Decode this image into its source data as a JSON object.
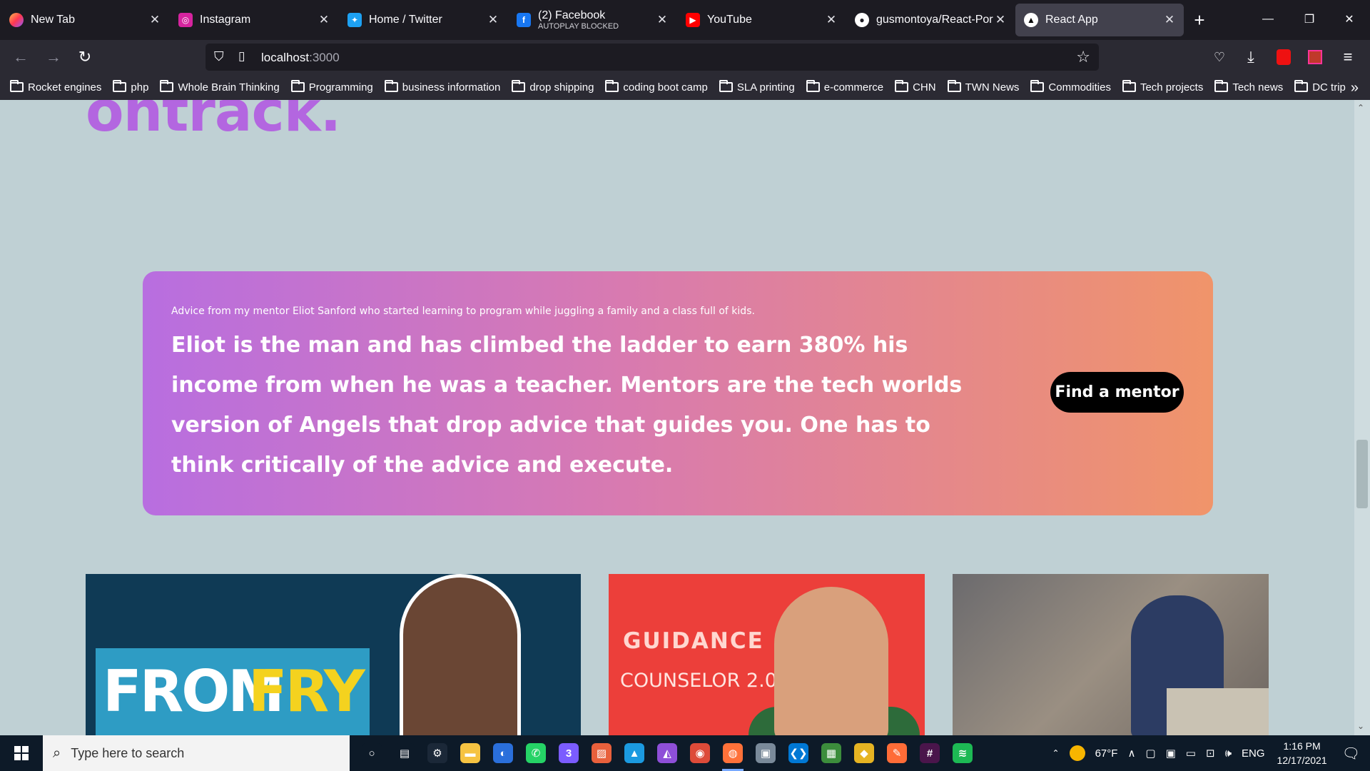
{
  "tabs": [
    {
      "title": "New Tab",
      "subtitle": "",
      "icon": "firefox-icon",
      "color": "#ff7139",
      "glyph": ""
    },
    {
      "title": "Instagram",
      "subtitle": "",
      "icon": "instagram-icon",
      "color": "#d6249f",
      "glyph": "◎"
    },
    {
      "title": "Home / Twitter",
      "subtitle": "",
      "icon": "twitter-icon",
      "color": "#1da1f2",
      "glyph": "✦"
    },
    {
      "title": "(2) Facebook",
      "subtitle": "AUTOPLAY BLOCKED",
      "icon": "facebook-icon",
      "color": "#1877f2",
      "glyph": "f"
    },
    {
      "title": "YouTube",
      "subtitle": "",
      "icon": "youtube-icon",
      "color": "#ff0000",
      "glyph": "▶"
    },
    {
      "title": "gusmontoya/React-Portf",
      "subtitle": "",
      "icon": "github-icon",
      "color": "#ffffff",
      "glyph": "●"
    },
    {
      "title": "React App",
      "subtitle": "",
      "icon": "react-app-icon",
      "color": "#000000",
      "glyph": "▲"
    }
  ],
  "url": {
    "host": "localhost",
    "port": ":3000"
  },
  "bookmarks": [
    "Rocket engines",
    "php",
    "Whole Brain Thinking",
    "Programming",
    "business information",
    "drop shipping",
    "coding boot camp",
    "SLA printing",
    "e-commerce",
    "CHN",
    "TWN News",
    "Commodities",
    "Tech projects",
    "Tech news",
    "DC trip"
  ],
  "page": {
    "heading_fragment": "ontrack.",
    "banner": {
      "subtitle": "Advice from my mentor Eliot Sanford who started learning to program while juggling a family and a class full of kids.",
      "quote": "Eliot is the man and has climbed the ladder to earn 380% his income from when he was a teacher. Mentors are the tech worlds version of Angels that drop advice that guides you. One has to think critically of the advice and execute.",
      "button_label": "Find a mentor"
    },
    "cards": [
      {
        "text_a": "FROM",
        "text_b": "FRY"
      },
      {
        "text_a": "GUIDANCE",
        "text_b": "COUNSELOR 2.0"
      },
      {
        "text_a": "",
        "text_b": ""
      }
    ],
    "colors": {
      "accent": "#b366e0",
      "background": "#bfd0d4",
      "gradient_start": "#b86ee0",
      "gradient_end": "#f0946a"
    }
  },
  "taskbar": {
    "search_placeholder": "Type here to search",
    "apps": [
      {
        "name": "cortana-icon",
        "color": "#0d1a28",
        "glyph": "○",
        "running": false
      },
      {
        "name": "task-view-icon",
        "color": "#0d1a28",
        "glyph": "▤",
        "running": false
      },
      {
        "name": "steam-icon",
        "color": "#1b2838",
        "glyph": "⚙",
        "running": false
      },
      {
        "name": "file-explorer-icon",
        "color": "#f6c342",
        "glyph": "▬",
        "running": false
      },
      {
        "name": "app-blue-circle-icon",
        "color": "#2a6fdb",
        "glyph": "◐",
        "running": false
      },
      {
        "name": "whatsapp-icon",
        "color": "#25d366",
        "glyph": "✆",
        "running": false
      },
      {
        "name": "messenger-icon",
        "color": "#7b5cff",
        "glyph": "3",
        "running": false
      },
      {
        "name": "affinity-publisher-icon",
        "color": "#e8603c",
        "glyph": "▨",
        "running": false
      },
      {
        "name": "affinity-designer-icon",
        "color": "#1b9ae0",
        "glyph": "▲",
        "running": false
      },
      {
        "name": "affinity-photo-icon",
        "color": "#8e4fd8",
        "glyph": "◭",
        "running": false
      },
      {
        "name": "chrome-icon",
        "color": "#dd4b39",
        "glyph": "◉",
        "running": false
      },
      {
        "name": "firefox-icon",
        "color": "#ff7139",
        "glyph": "◍",
        "running": true
      },
      {
        "name": "app-gray-icon",
        "color": "#7a8a9a",
        "glyph": "▣",
        "running": false
      },
      {
        "name": "vscode-icon",
        "color": "#0078d4",
        "glyph": "❮❯",
        "running": false
      },
      {
        "name": "app-green-icon",
        "color": "#3c8d3c",
        "glyph": "▦",
        "running": false
      },
      {
        "name": "sketchup-icon",
        "color": "#e6b422",
        "glyph": "◆",
        "running": false
      },
      {
        "name": "postman-icon",
        "color": "#ff6c37",
        "glyph": "✎",
        "running": false
      },
      {
        "name": "slack-icon",
        "color": "#4a154b",
        "glyph": "#",
        "running": false
      },
      {
        "name": "spotify-icon",
        "color": "#1db954",
        "glyph": "≋",
        "running": false
      }
    ],
    "weather": "67°F",
    "language": "ENG",
    "time": "1:16 PM",
    "date": "12/17/2021"
  }
}
